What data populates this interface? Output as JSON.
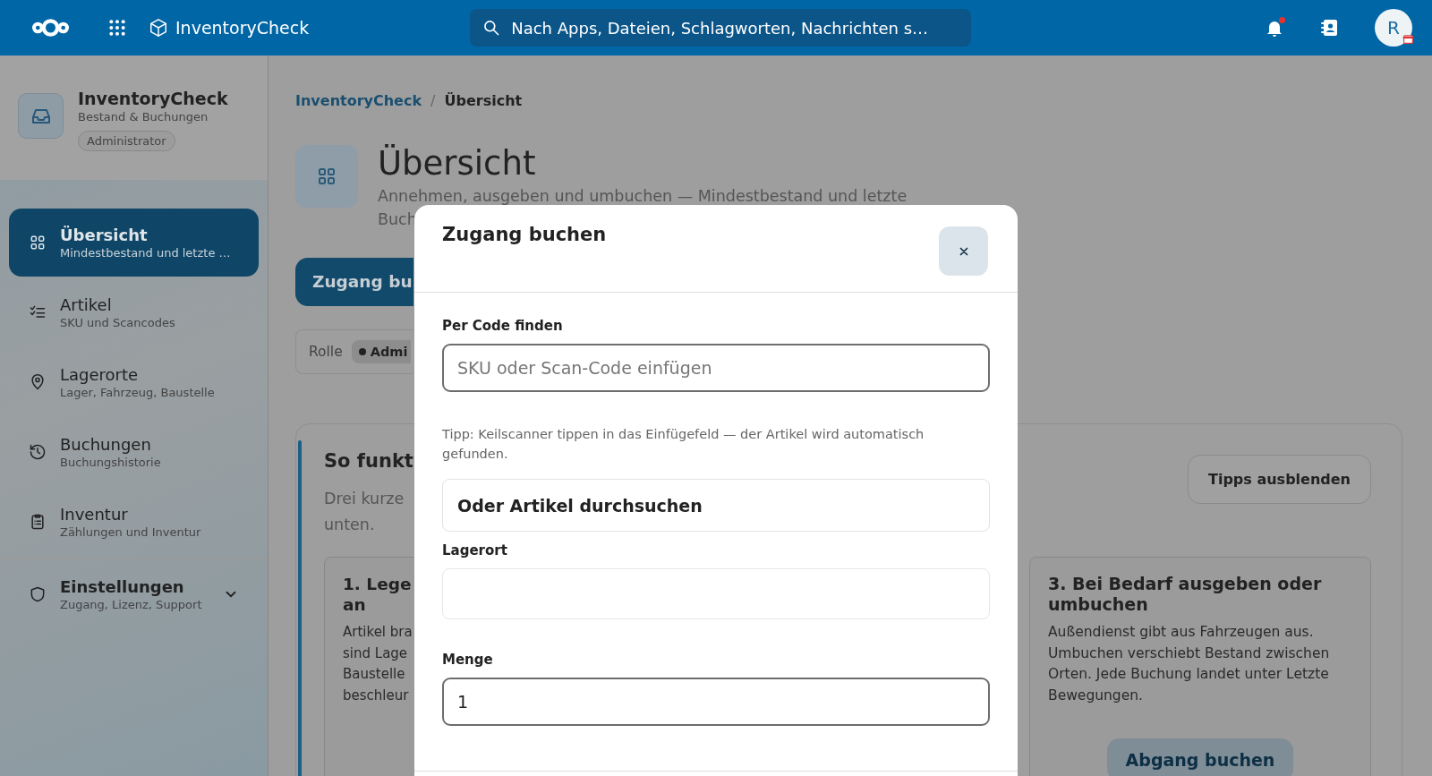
{
  "topbar": {
    "app_name": "InventoryCheck",
    "search": {
      "placeholder": "Nach Apps, Dateien, Schlagworten, Nachrichten s…"
    },
    "notifications_unread": true,
    "avatar": {
      "initial": "R"
    }
  },
  "sidebar": {
    "app": {
      "title": "InventoryCheck",
      "subtitle": "Bestand & Buchungen",
      "role": "Administrator"
    },
    "items": [
      {
        "kind": "link",
        "label": "Übersicht",
        "description": "Mindestbestand und letzte …",
        "selected": true
      },
      {
        "kind": "link",
        "label": "Artikel",
        "description": "SKU und Scancodes",
        "selected": false
      },
      {
        "kind": "link",
        "label": "Lagerorte",
        "description": "Lager, Fahrzeug, Baustelle",
        "selected": false
      },
      {
        "kind": "link",
        "label": "Buchungen",
        "description": "Buchungshistorie",
        "selected": false
      },
      {
        "kind": "link",
        "label": "Inventur",
        "description": "Zählungen und Inventur",
        "selected": false
      },
      {
        "kind": "group",
        "label": "Einstellungen",
        "description": "Zugang, Lizenz, Support",
        "selected": false,
        "expanded": false
      }
    ]
  },
  "main": {
    "breadcrumb_separator": "/",
    "breadcrumb": [
      {
        "label": "InventoryCheck",
        "current": false
      },
      {
        "label": "Übersicht",
        "current": true
      }
    ],
    "title": "Übersicht",
    "subtitle": "Annehmen, ausgeben und umbuchen — Mindestbestand und letzte\nBuch",
    "primary_button": "Zugang bu",
    "role": {
      "label": "Rolle",
      "value": "Admi"
    },
    "tips": {
      "title": "So funkt",
      "intro": "Drei kurze\nunten.",
      "hide_button": "Tipps ausblenden",
      "steps": [
        {
          "title": "1. Lege\nan",
          "text": "Artikel bra\nsind Lage\nBaustelle\nbeschleur"
        },
        {
          "title": "3. Bei Bedarf ausgeben oder umbuchen",
          "text": "Außendienst gibt aus Fahrzeugen aus. Umbuchen verschiebt Bestand zwischen Orten. Jede Buchung landet unter Letzte Bewegungen.",
          "button": "Abgang buchen"
        }
      ]
    }
  },
  "dialog": {
    "title": "Zugang buchen",
    "fields": [
      {
        "kind": "code",
        "label": "Per Code finden",
        "placeholder": "SKU oder Scan-Code einfügen"
      },
      {
        "kind": "hint",
        "text": "Tipp: Keilscanner tippen in das Einfügefeld — der Artikel wird automatisch gefunden."
      },
      {
        "kind": "search",
        "text": "Oder Artikel durchsuchen"
      },
      {
        "kind": "select",
        "label": "Lagerort"
      },
      {
        "kind": "number",
        "label": "Menge",
        "value": "1"
      }
    ]
  }
}
